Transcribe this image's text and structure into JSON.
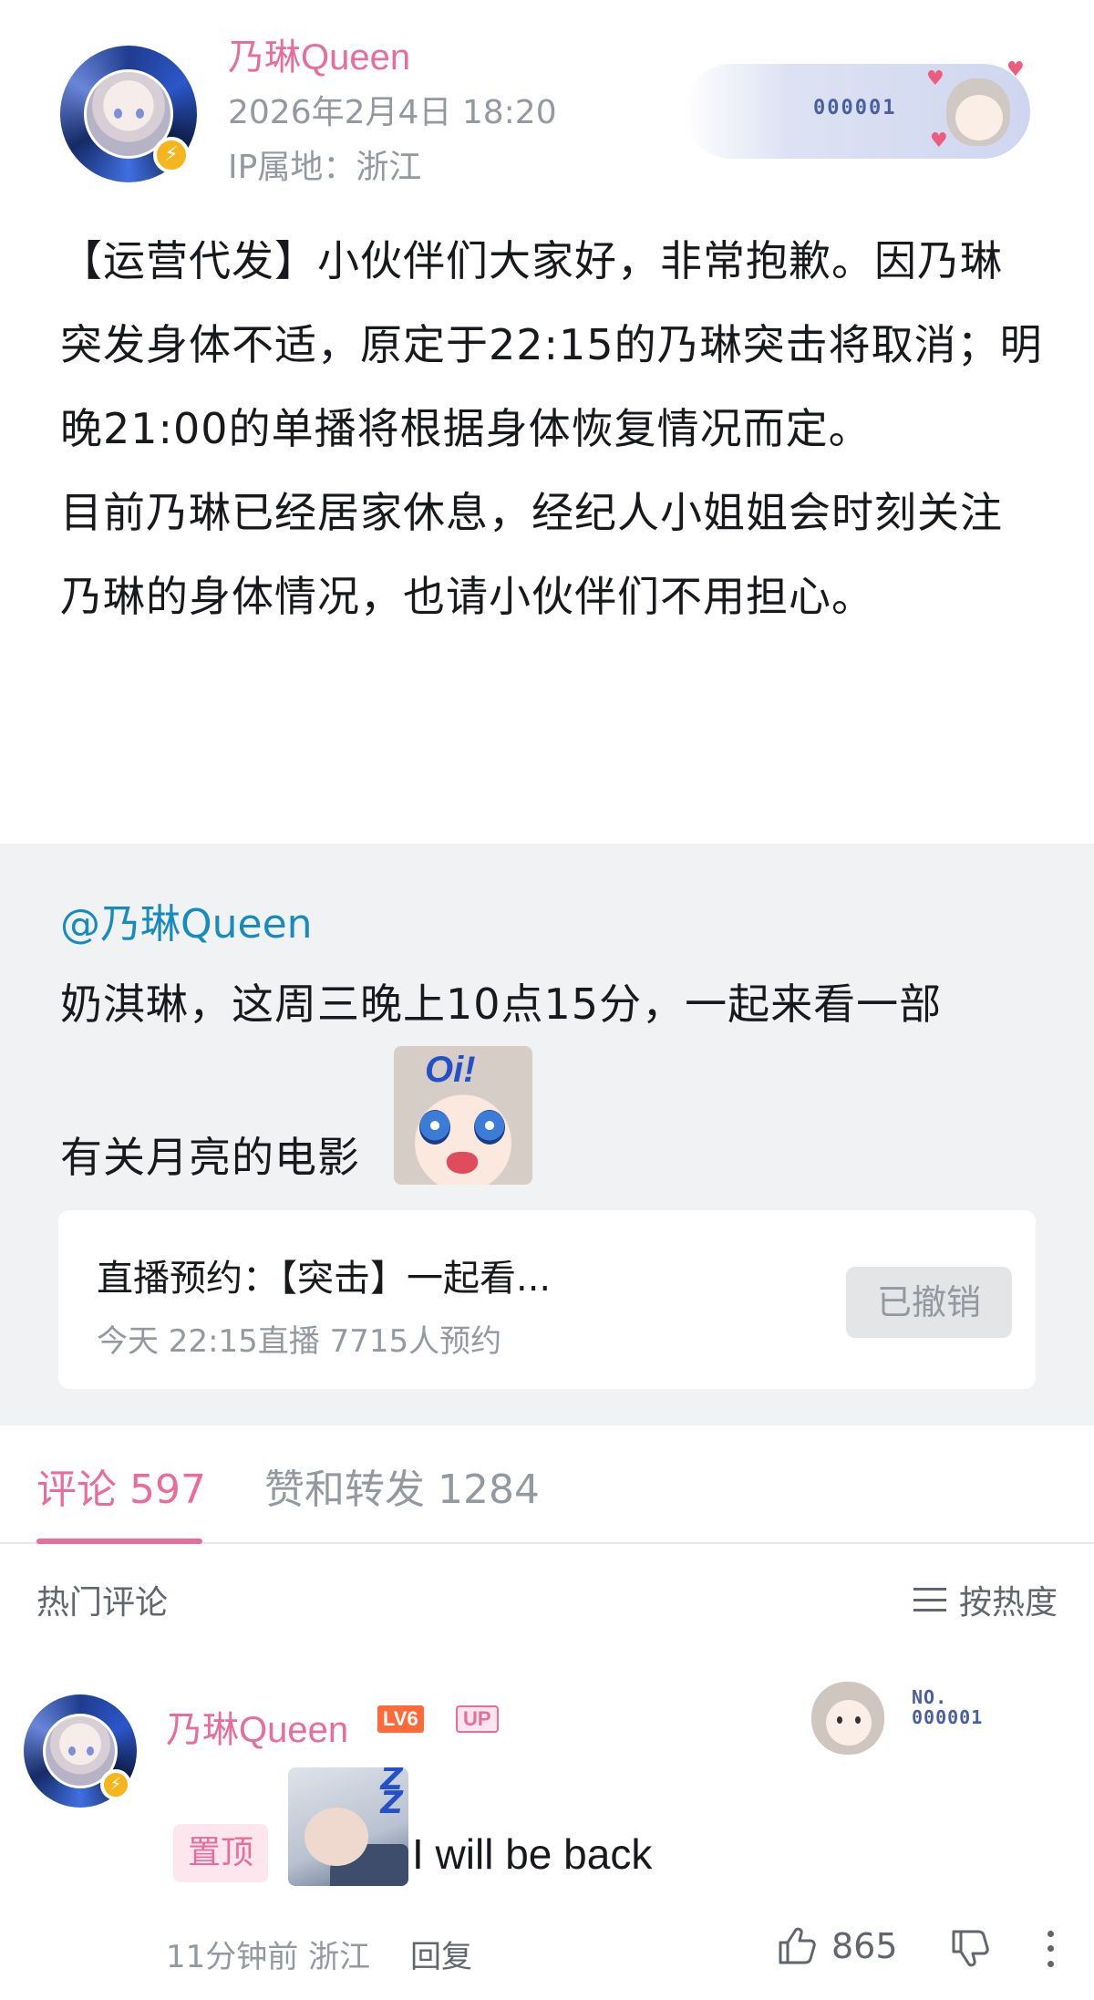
{
  "post": {
    "author": "乃琳Queen",
    "time": "2026年2月4日 18:20",
    "ip": "IP属地：浙江",
    "fan_card_number": "000001",
    "paragraphs": [
      "【运营代发】小伙伴们大家好，非常抱歉。因乃琳突发身体不适，原定于22:15的乃琳突击将取消；明晚21:00的单播将根据身体恢复情况而定。",
      "目前乃琳已经居家休息，经纪人小姐姐会时刻关注乃琳的身体情况，也请小伙伴们不用担心。"
    ]
  },
  "repost": {
    "mention": "@乃琳Queen",
    "line1": "奶淇琳，这周三晚上10点15分，一起来看一部",
    "line2": "有关月亮的电影",
    "sticker_text": "Oi!",
    "reservation": {
      "title": "直播预约：【突击】一起看...",
      "meta": "今天 22:15直播    7715人预约",
      "button": "已撤销"
    }
  },
  "tabs": {
    "comments": "评论 597",
    "likes_reposts": "赞和转发 1284"
  },
  "comments_header": {
    "hot": "热门评论",
    "sort": "按热度"
  },
  "comment": {
    "author": "乃琳Queen",
    "level": "LV6",
    "up_badge": "UP",
    "fan_label": "NO.\n000001",
    "pinned": "置顶",
    "text": "I will be back",
    "meta": "11分钟前 浙江",
    "reply": "回复",
    "likes": "865"
  },
  "colors": {
    "accent_pink": "#e86d9a",
    "mention_blue": "#178bbd",
    "muted_gray": "#9499a0",
    "repost_bg": "#f1f2f3"
  },
  "icons": [
    "verified-badge-icon",
    "menu-lines-icon",
    "thumbs-up-icon",
    "thumbs-down-icon",
    "more-vertical-icon"
  ]
}
